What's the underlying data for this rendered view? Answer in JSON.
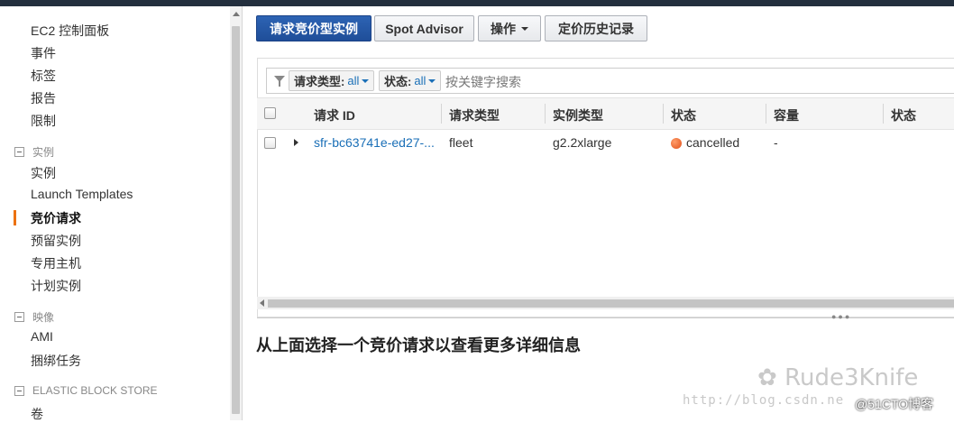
{
  "sidebar": {
    "top_items": [
      "EC2 控制面板",
      "事件",
      "标签",
      "报告",
      "限制"
    ],
    "section_instances": {
      "title": "实例",
      "items": [
        "实例",
        "Launch Templates",
        "竞价请求",
        "预留实例",
        "专用主机",
        "计划实例"
      ],
      "active_index": 2
    },
    "section_images": {
      "title": "映像",
      "items": [
        "AMI",
        "捆绑任务"
      ]
    },
    "section_ebs": {
      "title": "ELASTIC BLOCK STORE",
      "items": [
        "卷"
      ]
    }
  },
  "toolbar": {
    "request_spot_label": "请求竞价型实例",
    "spot_advisor_label": "Spot Advisor",
    "actions_label": "操作",
    "pricing_history_label": "定价历史记录"
  },
  "filter": {
    "request_type_label": "请求类型:",
    "request_type_value": "all",
    "state_label": "状态:",
    "state_value": "all",
    "placeholder": "按关键字搜索"
  },
  "table": {
    "columns": [
      "请求 ID",
      "请求类型",
      "实例类型",
      "状态",
      "容量",
      "状态"
    ],
    "rows": [
      {
        "request_id": "sfr-bc63741e-ed27-...",
        "request_type": "fleet",
        "instance_type": "g2.2xlarge",
        "state": "cancelled",
        "capacity": "-"
      }
    ]
  },
  "detail": {
    "message": "从上面选择一个竞价请求以查看更多详细信息"
  },
  "watermark": {
    "logo_text": "Rude3Knife",
    "url": "http://blog.csdn.ne",
    "site": "@51CTO博客"
  },
  "colors": {
    "primary_button": "#1f4e99",
    "active_nav_marker": "#ec7211",
    "link": "#1a6fb7",
    "status_cancelled": "#e0501a",
    "topbar": "#232f3e"
  }
}
